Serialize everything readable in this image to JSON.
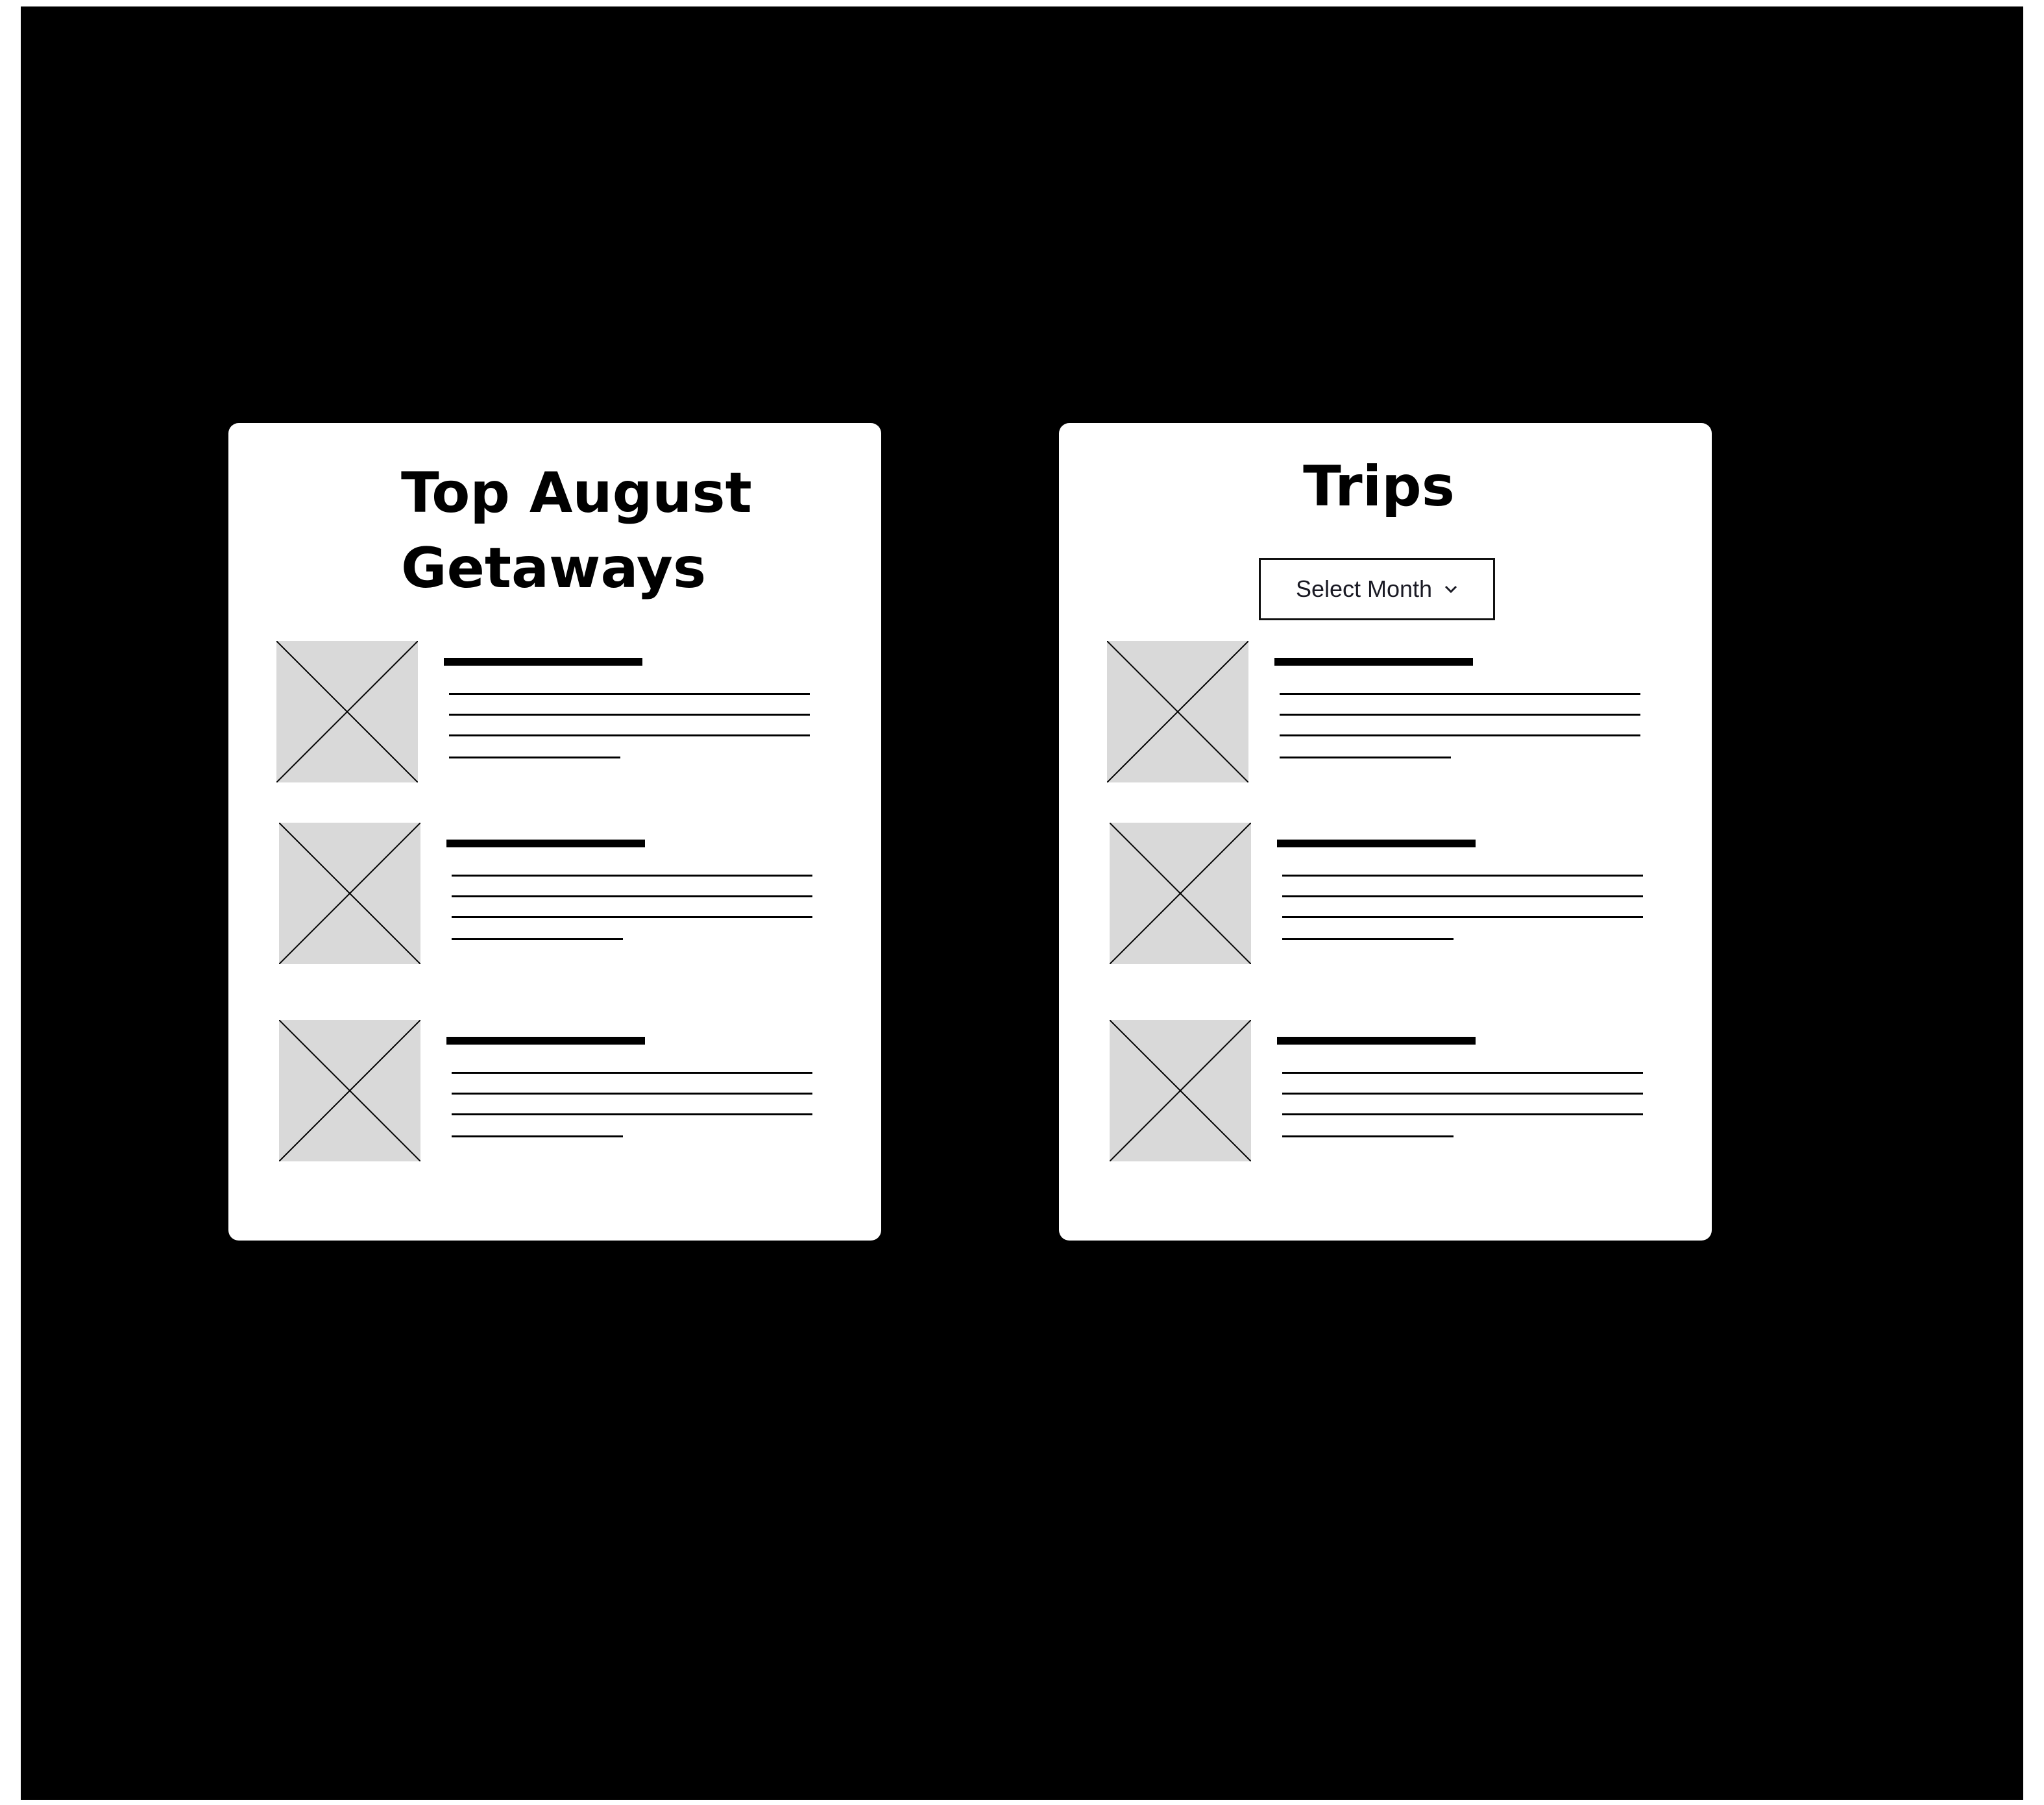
{
  "left_card": {
    "title": "Top August Getaways",
    "items": [
      {
        "image": "image-placeholder"
      },
      {
        "image": "image-placeholder"
      },
      {
        "image": "image-placeholder"
      }
    ]
  },
  "right_card": {
    "title": "Trips",
    "select": {
      "label": "Select Month",
      "icon": "chevron-down-icon"
    },
    "items": [
      {
        "image": "image-placeholder"
      },
      {
        "image": "image-placeholder"
      },
      {
        "image": "image-placeholder"
      }
    ]
  },
  "colors": {
    "background": "#000000",
    "card": "#ffffff",
    "placeholder": "#d9d9d9"
  }
}
